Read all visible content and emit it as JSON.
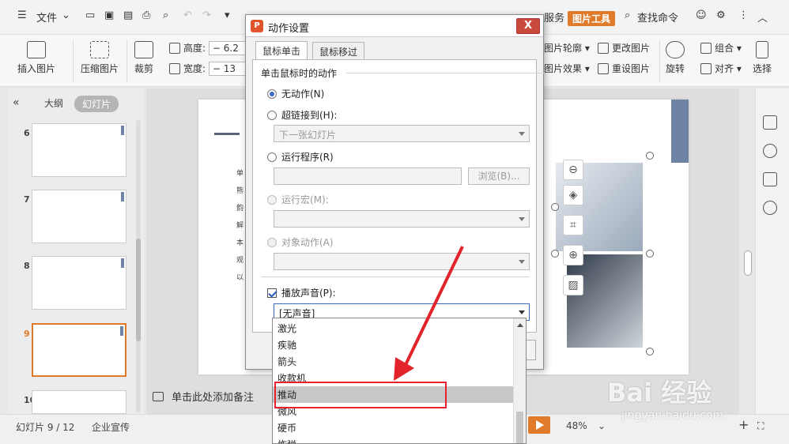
{
  "menubar": {
    "file_menu": "文件",
    "tab_service": "服务",
    "tab_picture_tools": "图片工具",
    "find_command": "查找命令"
  },
  "ribbon": {
    "insert_picture": "插入图片",
    "compress_picture": "压缩图片",
    "crop": "裁剪",
    "height_label": "高度:",
    "height_value": "6.2",
    "width_label": "宽度:",
    "width_value": "13",
    "picture_outline": "图片轮廓",
    "picture_effects": "图片效果",
    "change_picture": "更改图片",
    "reset_picture": "重设图片",
    "rotate": "旋转",
    "group": "组合",
    "align": "对齐",
    "select": "选择"
  },
  "left_panel": {
    "tab_outline": "大纲",
    "tab_slides": "幻灯片",
    "slide_numbers": [
      "6",
      "7",
      "8",
      "9",
      "10"
    ],
    "selected_slide": "9"
  },
  "slide_text_lines": [
    "单",
    "熊",
    "韵",
    "解",
    "本",
    "观",
    "以"
  ],
  "notes_placeholder": "单击此处添加备注",
  "status": {
    "slide_counter": "幻灯片 9 / 12",
    "theme": "企业宣传",
    "zoom": "48%"
  },
  "dialog": {
    "title": "动作设置",
    "close": "X",
    "tab_click": "鼠标单击",
    "tab_hover": "鼠标移过",
    "group_title": "单击鼠标时的动作",
    "opt_none": "无动作(N)",
    "opt_hyperlink": "超链接到(H):",
    "hyperlink_value": "下一张幻灯片",
    "opt_run_program": "运行程序(R)",
    "browse": "浏览(B)...",
    "opt_run_macro": "运行宏(M):",
    "opt_object_action": "对象动作(A)",
    "play_sound": "播放声音(P):",
    "sound_value": "[无声音]",
    "sound_options": [
      "激光",
      "疾驰",
      "箭头",
      "收款机",
      "推动",
      "微风",
      "硬币",
      "炸弹"
    ],
    "selected_sound": "推动"
  },
  "watermark": {
    "brand": "Bai 经验",
    "url": "jingyan.baidu.com"
  },
  "colors": {
    "accent_orange": "#e07b2b",
    "highlight_red": "#e2232a",
    "radio_blue": "#3b6bc6"
  }
}
